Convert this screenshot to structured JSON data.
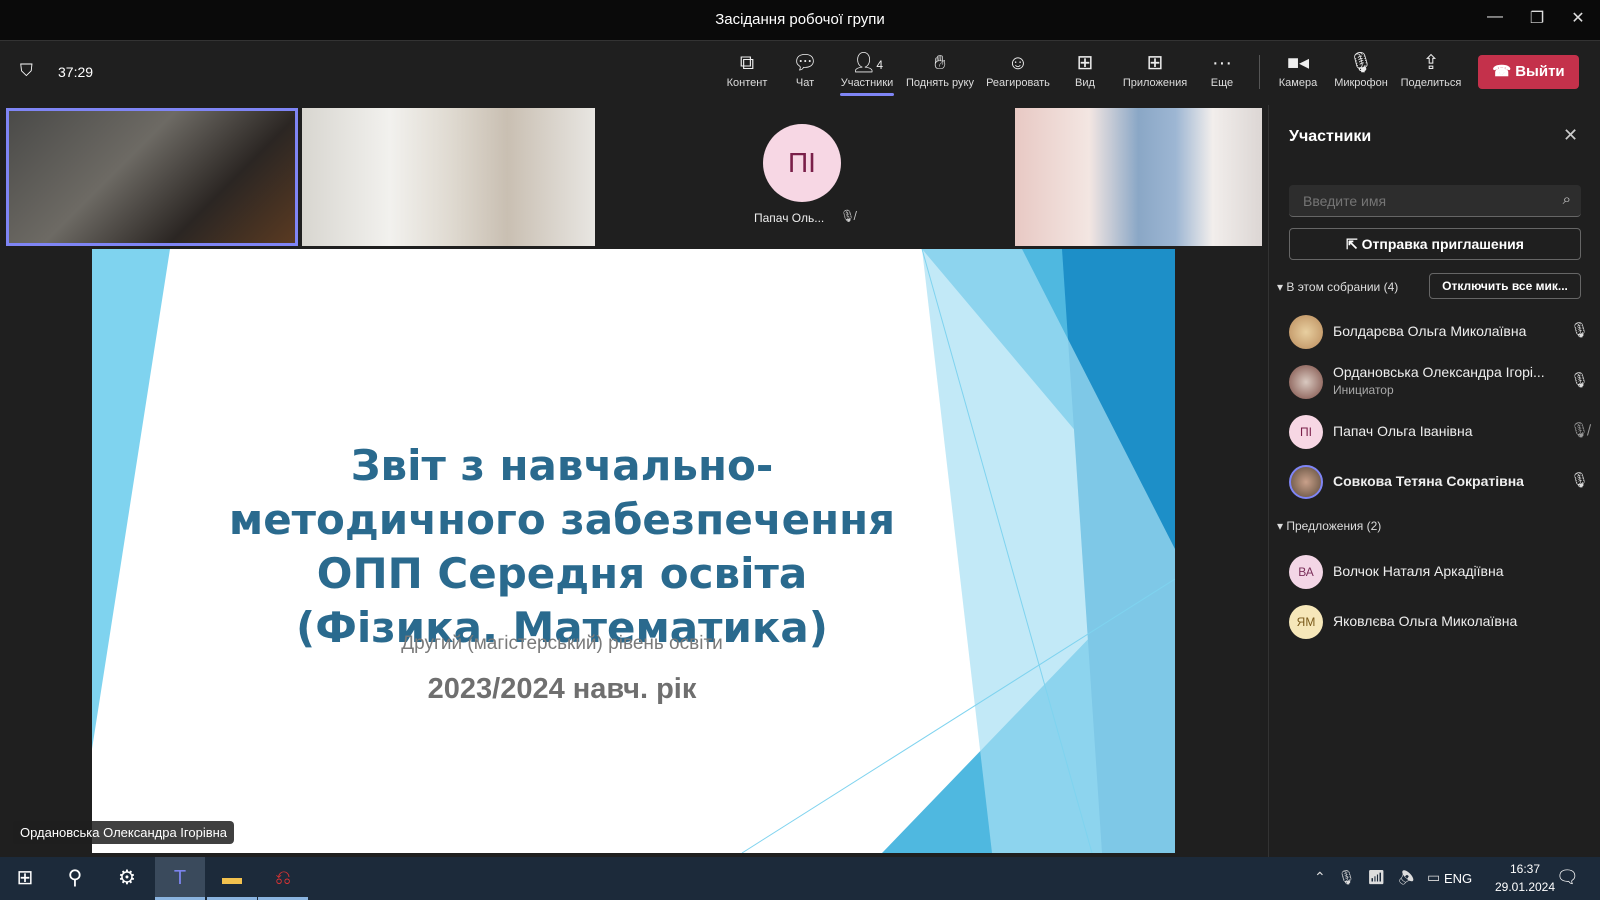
{
  "window": {
    "title": "Засідання робочої групи"
  },
  "toolbar": {
    "timer": "37:29",
    "items": [
      {
        "label": "Контент",
        "icon": "share-content-icon"
      },
      {
        "label": "Чат",
        "icon": "chat-icon"
      },
      {
        "label": "Участники",
        "icon": "people-icon",
        "badge": "4",
        "active": true
      },
      {
        "label": "Поднять руку",
        "icon": "raise-hand-icon"
      },
      {
        "label": "Реагировать",
        "icon": "smiley-icon"
      },
      {
        "label": "Вид",
        "icon": "grid-icon"
      },
      {
        "label": "Приложения",
        "icon": "plus-square-icon"
      },
      {
        "label": "Еще",
        "icon": "more-icon"
      },
      {
        "label": "Камера",
        "icon": "camera-icon"
      },
      {
        "label": "Микрофон",
        "icon": "microphone-icon"
      },
      {
        "label": "Поделиться",
        "icon": "upload-icon"
      }
    ],
    "leave_label": "Выйти",
    "leave_color": "#c4314b"
  },
  "videos": {
    "tile3_initials": "ПІ",
    "tile3_name": "Папач Оль..."
  },
  "slide": {
    "title": "Звіт з навчально-методичного забезпечення ОПП Середня освіта (Фізика. Математика)",
    "subtitle": "Другий (магістерський) рівень освіти",
    "year": "2023/2024 навч. рік",
    "speaker": "Ордановська Олександра Ігорівна"
  },
  "panel": {
    "title": "Участники",
    "search_placeholder": "Введите имя",
    "invite_label": "Отправка приглашения",
    "section1": "В этом собрании (4)",
    "mute_all": "Отключить все мик...",
    "in_meeting": [
      {
        "name": "Болдарєва Ольга Миколаївна",
        "mic": "on"
      },
      {
        "name": "Ордановська Олександра Ігорі...",
        "role": "Инициатор",
        "mic": "on"
      },
      {
        "name": "Папач Ольга Іванівна",
        "initials": "ПІ",
        "mic": "muted"
      },
      {
        "name": "Совкова Тетяна Сократівна",
        "mic": "on"
      }
    ],
    "section2": "Предложения (2)",
    "suggested": [
      {
        "name": "Волчок Наталя Аркадіївна",
        "initials": "ВА"
      },
      {
        "name": "Яковлєва Ольга Миколаївна",
        "initials": "ЯМ"
      }
    ]
  },
  "taskbar": {
    "lang": "ENG",
    "time": "16:37",
    "date": "29.01.2024"
  }
}
